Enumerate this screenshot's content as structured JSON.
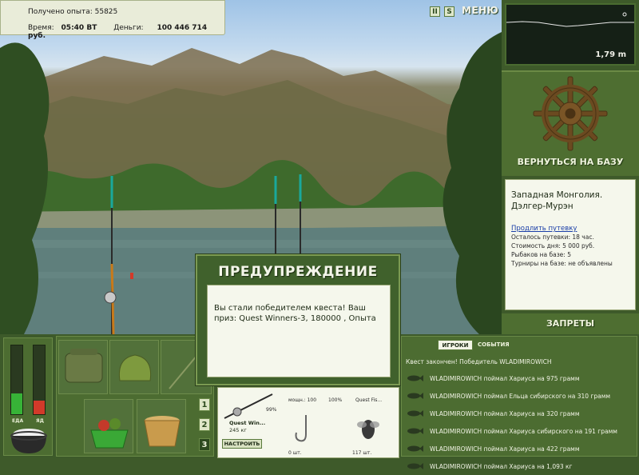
{
  "stats": {
    "exp_label": "Получено опыта:",
    "exp_value": "55825",
    "time_label": "Время:",
    "time_value": "05:40 ВТ",
    "money_label": "Деньги:",
    "money_value": "100 446 714 руб."
  },
  "controls": {
    "pause": "II",
    "sound": "S",
    "menu": "МЕНЮ"
  },
  "depth": {
    "value": "1,79 m"
  },
  "base": {
    "return_label": "ВЕРНУТЬСЯ НА БАЗУ"
  },
  "location": {
    "title_line1": "Западная Монголия.",
    "title_line2": "Дэлгер-Мурэн",
    "extend_link": "Продлить путевку",
    "line1": "Осталось путевки: 18 час.",
    "line2": "Стоимость дня: 5 000 руб.",
    "line3": "Рыбаков на базе: 5",
    "line4": "Турниры на базе: не объявлены"
  },
  "bans_label": "ЗАПРЕТЫ",
  "meters": {
    "food_label": "ЕДА",
    "food_level": 0.3,
    "poison_label": "ЯД",
    "poison_level": 0.2
  },
  "inventory_tabs": [
    "1",
    "2",
    "3"
  ],
  "tackle": {
    "rod_name": "Quest Win...",
    "rod_weight": "245 кг",
    "rod_percent": "99%",
    "slot1_info": "мощн.: 100",
    "slot1_percent": "100%",
    "slot2_name": "Quest Fis...",
    "slot3_count": "0 шт.",
    "slot4_count": "117 шт.",
    "tune_button": "НАСТРОИТЬ"
  },
  "modal": {
    "title": "ПРЕДУПРЕЖДЕНИЕ",
    "message": "Вы стали победителем квеста! Ваш приз: Quest Winners-3, 180000 , Опыта"
  },
  "log": {
    "tab_players": "ИГРОКИ",
    "tab_events": "СОБЫТИЯ",
    "header": "Квест закончен! Победитель WLADIMIROWICH",
    "entries": [
      "WLADIMIROWICH поймал Хариуса на 975 грамм",
      "WLADIMIROWICH поймал Ельца сибирского на 310 грамм",
      "WLADIMIROWICH поймал Хариуса на 320 грамм",
      "WLADIMIROWICH поймал Хариуса сибирского на 191 грамм",
      "WLADIMIROWICH поймал Хариуса на 422 грамм",
      "WLADIMIROWICH поймал Хариуса на 1,093 кг"
    ]
  },
  "colors": {
    "panel_green": "#4e6e31",
    "light_panel": "#f5f7ec",
    "link_blue": "#1a3ea8",
    "food_green": "#37b337",
    "poison_red": "#d23a2a"
  },
  "icons": {
    "wheel": "ship-wheel-icon",
    "fish": "fish-icon",
    "pot": "pot-icon",
    "bag": "bag-icon",
    "bucket": "bucket-icon"
  }
}
